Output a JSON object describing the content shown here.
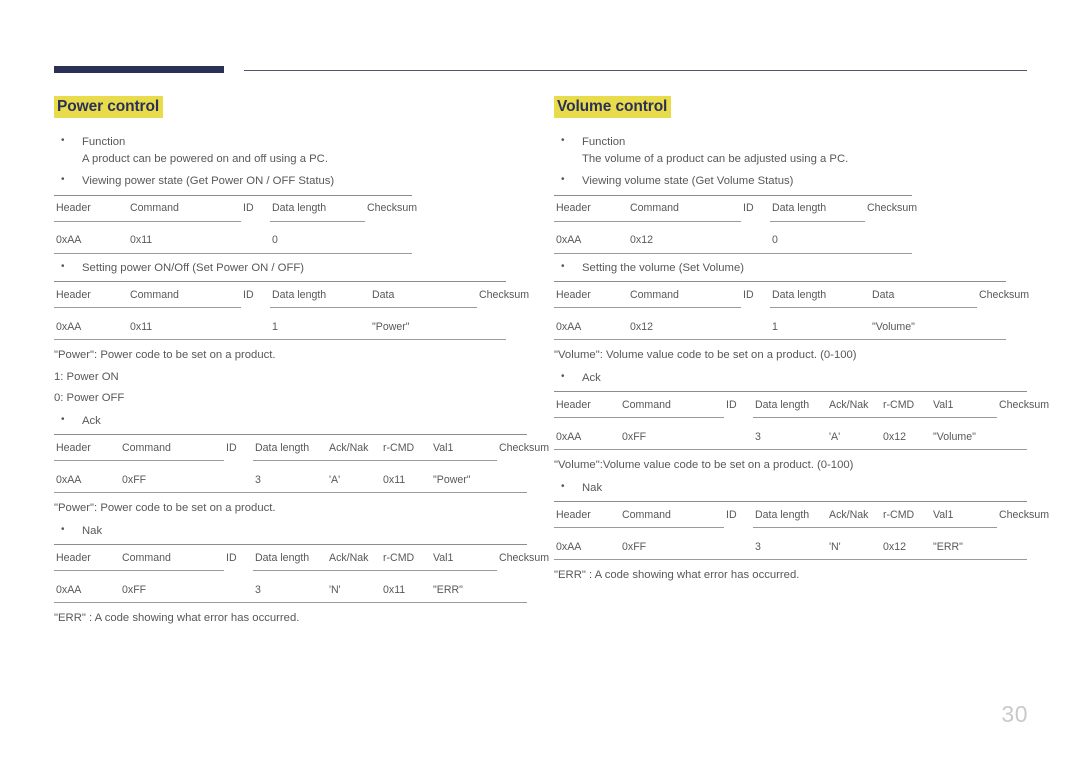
{
  "page": {
    "number": "30",
    "accent_navy": "#2b3156",
    "highlight_yellow": "#e9dc4c",
    "text_gray": "#58585b",
    "rule_gray": "#9a9a9a"
  },
  "sections": [
    {
      "title": "Power control",
      "function_label": "Function",
      "function_text": "A product can be powered on and off using a PC.",
      "blocks": [
        {
          "bullet": "Viewing power state (Get Power ON / OFF Status)",
          "headers": [
            "Header",
            "Command",
            "ID",
            "Data length",
            "Checksum"
          ],
          "values": [
            "0xAA",
            "0x11",
            "",
            "0",
            ""
          ],
          "note": ""
        },
        {
          "bullet": "Setting power ON/Off (Set Power ON / OFF)",
          "headers": [
            "Header",
            "Command",
            "ID",
            "Data length",
            "Data",
            "Checksum"
          ],
          "values": [
            "0xAA",
            "0x11",
            "",
            "1",
            "\"Power\"",
            ""
          ],
          "note": "\"Power\": Power code to be set on a product.",
          "note_lines": [
            "1: Power ON",
            "0: Power OFF"
          ]
        },
        {
          "bullet": "Ack",
          "headers": [
            "Header",
            "Command",
            "ID",
            "Data length",
            "Ack/Nak",
            "r-CMD",
            "Val1",
            "Checksum"
          ],
          "values": [
            "0xAA",
            "0xFF",
            "",
            "3",
            "'A'",
            "0x11",
            "\"Power\"",
            ""
          ],
          "note": "\"Power\": Power code to be set on a product."
        },
        {
          "bullet": "Nak",
          "headers": [
            "Header",
            "Command",
            "ID",
            "Data length",
            "Ack/Nak",
            "r-CMD",
            "Val1",
            "Checksum"
          ],
          "values": [
            "0xAA",
            "0xFF",
            "",
            "3",
            "'N'",
            "0x11",
            "\"ERR\"",
            ""
          ],
          "note": "\"ERR\" : A code showing what error has occurred."
        }
      ]
    },
    {
      "title": "Volume control",
      "function_label": "Function",
      "function_text": "The volume of a product can be adjusted using a PC.",
      "blocks": [
        {
          "bullet": "Viewing volume state (Get Volume Status)",
          "headers": [
            "Header",
            "Command",
            "ID",
            "Data length",
            "Checksum"
          ],
          "values": [
            "0xAA",
            "0x12",
            "",
            "0",
            ""
          ],
          "note": ""
        },
        {
          "bullet": "Setting the volume (Set Volume)",
          "headers": [
            "Header",
            "Command",
            "ID",
            "Data length",
            "Data",
            "Checksum"
          ],
          "values": [
            "0xAA",
            "0x12",
            "",
            "1",
            "\"Volume\"",
            ""
          ],
          "note": "\"Volume\": Volume value code to be set on a product. (0-100)"
        },
        {
          "bullet": "Ack",
          "headers": [
            "Header",
            "Command",
            "ID",
            "Data length",
            "Ack/Nak",
            "r-CMD",
            "Val1",
            "Checksum"
          ],
          "values": [
            "0xAA",
            "0xFF",
            "",
            "3",
            "'A'",
            "0x12",
            "\"Volume\"",
            ""
          ],
          "note": "\"Volume\":Volume value code to be set on a product. (0-100)"
        },
        {
          "bullet": "Nak",
          "headers": [
            "Header",
            "Command",
            "ID",
            "Data length",
            "Ack/Nak",
            "r-CMD",
            "Val1",
            "Checksum"
          ],
          "values": [
            "0xAA",
            "0xFF",
            "",
            "3",
            "'N'",
            "0x12",
            "\"ERR\"",
            ""
          ],
          "note": "\"ERR\" : A code showing what error has occurred."
        }
      ]
    }
  ]
}
